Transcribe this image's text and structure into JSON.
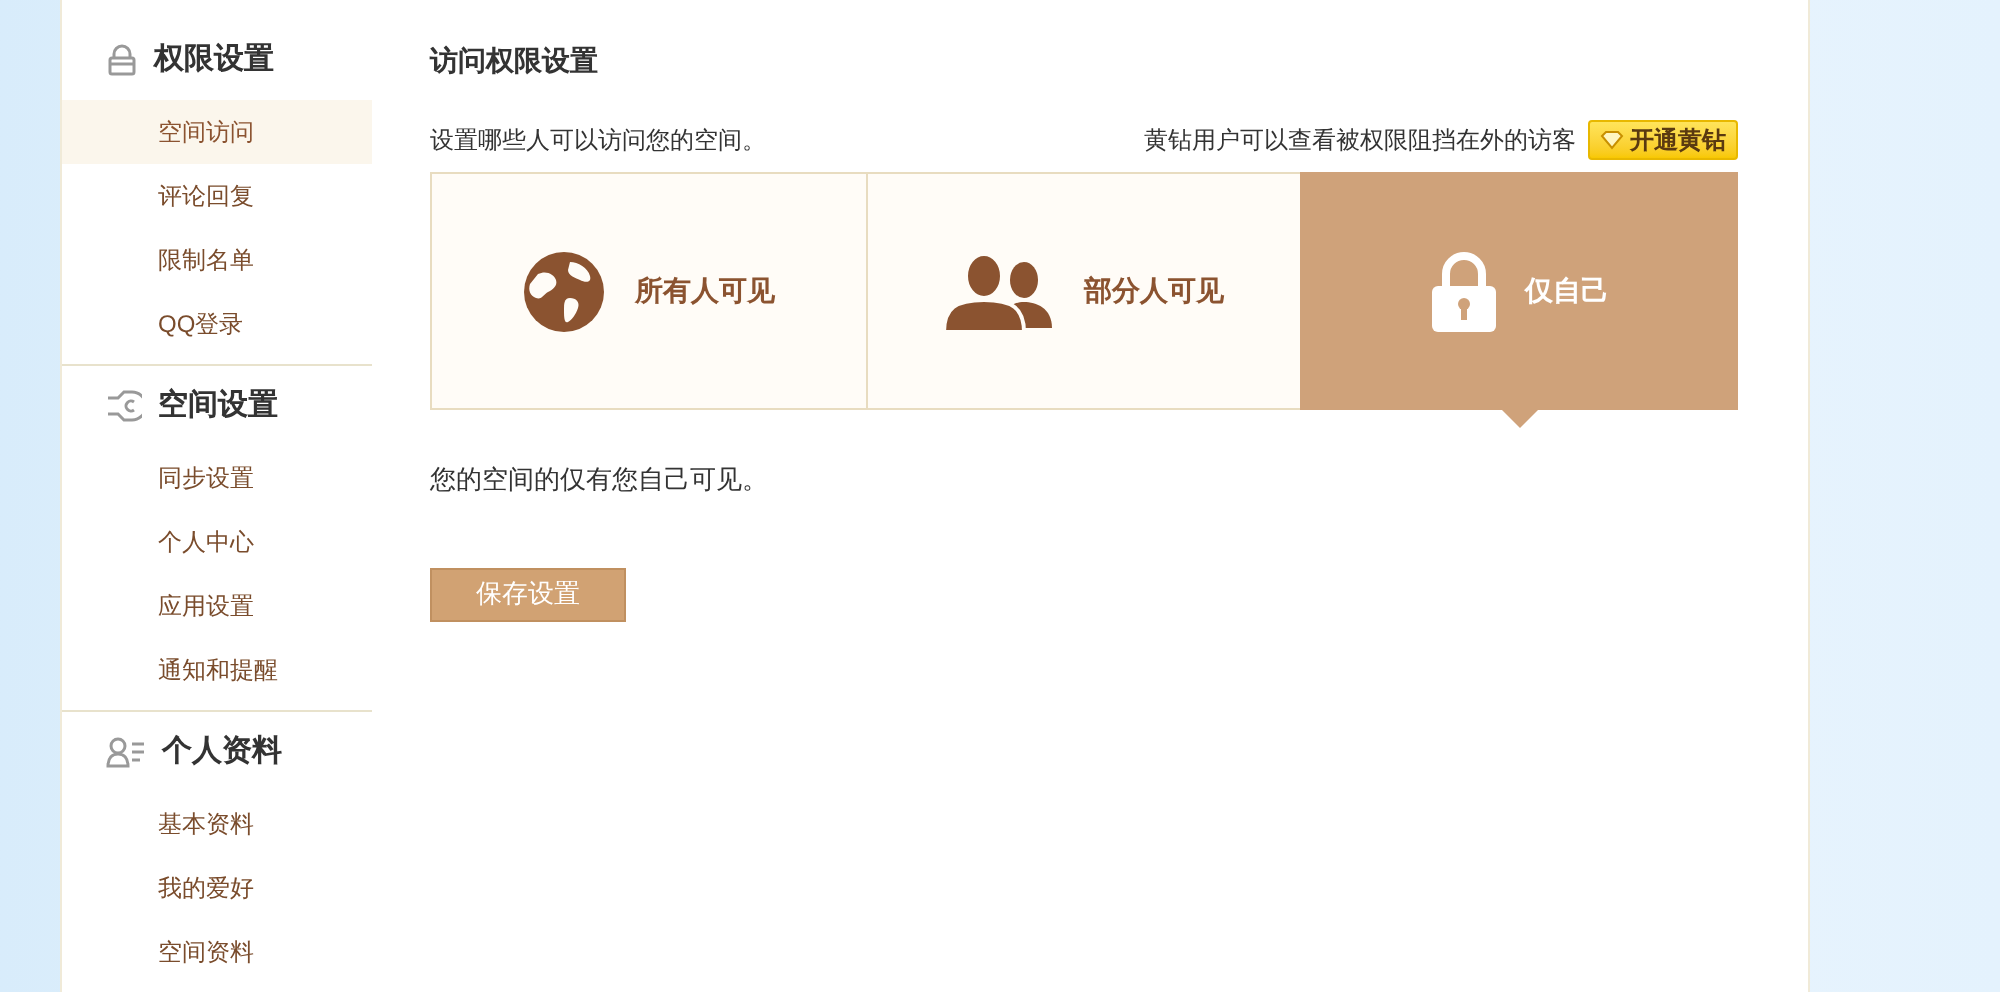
{
  "sidebar": {
    "groups": [
      {
        "kind": "lock",
        "title": "权限设置",
        "items": [
          {
            "label": "空间访问",
            "selected": true
          },
          {
            "label": "评论回复",
            "selected": false
          },
          {
            "label": "限制名单",
            "selected": false
          },
          {
            "label": "QQ登录",
            "selected": false
          }
        ]
      },
      {
        "kind": "plug",
        "title": "空间设置",
        "items": [
          {
            "label": "同步设置",
            "selected": false
          },
          {
            "label": "个人中心",
            "selected": false
          },
          {
            "label": "应用设置",
            "selected": false
          },
          {
            "label": "通知和提醒",
            "selected": false
          }
        ]
      },
      {
        "kind": "profile",
        "title": "个人资料",
        "items": [
          {
            "label": "基本资料",
            "selected": false
          },
          {
            "label": "我的爱好",
            "selected": false
          },
          {
            "label": "空间资料",
            "selected": false
          }
        ]
      }
    ]
  },
  "main": {
    "title": "访问权限设置",
    "description": "设置哪些人可以访问您的空间。",
    "vip_hint": "黄钻用户可以查看被权限阻挡在外的访客",
    "vip_button": "开通黄钻",
    "options": [
      {
        "kind": "globe",
        "label": "所有人可见",
        "selected": false
      },
      {
        "kind": "people",
        "label": "部分人可见",
        "selected": false
      },
      {
        "kind": "lock",
        "label": "仅自己",
        "selected": true
      }
    ],
    "result": "您的空间的仅有您自己可见。",
    "save_button": "保存设置"
  }
}
